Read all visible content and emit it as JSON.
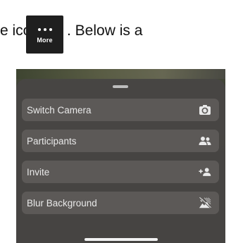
{
  "intro": {
    "prefix": "e icon",
    "suffix": ". Below is a",
    "more_icon_label": "More",
    "more_icon_name": "more-dots-icon"
  },
  "sheet": {
    "items": [
      {
        "label": "Switch Camera",
        "icon": "camera-switch-icon"
      },
      {
        "label": "Participants",
        "icon": "participants-icon"
      },
      {
        "label": "Invite",
        "icon": "add-person-icon"
      },
      {
        "label": "Blur Background",
        "icon": "blur-background-icon"
      }
    ]
  },
  "colors": {
    "sheet_bg": "#484644",
    "item_bg": "#5c5957",
    "item_text": "#e9e9e9",
    "more_icon_bg": "#1f1f1f"
  }
}
